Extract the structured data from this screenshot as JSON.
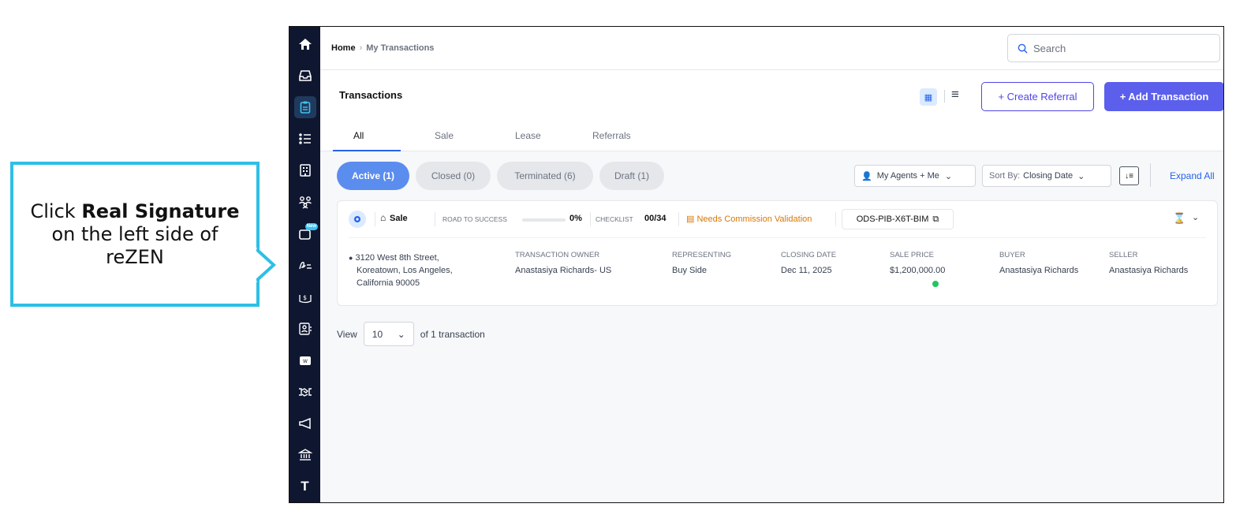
{
  "callout": {
    "pre": "Click ",
    "bold": "Real Signature",
    "post": " on the left side of reZEN"
  },
  "breadcrumb": {
    "home": "Home",
    "separator": "›",
    "current": "My Transactions"
  },
  "search": {
    "placeholder": "Search",
    "icon": "search-icon"
  },
  "header": {
    "title": "Transactions",
    "create_referral": "+ Create Referral",
    "add_transaction": "+ Add Transaction"
  },
  "tabs": [
    {
      "label": "All",
      "active": true
    },
    {
      "label": "Sale"
    },
    {
      "label": "Lease"
    },
    {
      "label": "Referrals"
    }
  ],
  "status_pills": [
    {
      "label": "Active (1)",
      "active": true
    },
    {
      "label": "Closed (0)"
    },
    {
      "label": "Terminated (6)"
    },
    {
      "label": "Draft (1)"
    }
  ],
  "filters": {
    "agents": "My Agents + Me",
    "sort_prefix": "Sort By:",
    "sort_value": "Closing Date",
    "expand_all": "Expand All"
  },
  "transaction": {
    "type": "Sale",
    "road_to_success_label": "ROAD TO SUCCESS",
    "road_to_success_pct": "0%",
    "checklist_label": "CHECKLIST",
    "checklist_value": "00/34",
    "needs_validation": "Needs Commission Validation",
    "code": "ODS-PIB-X6T-BIM",
    "address_line1": "3120 West 8th Street,",
    "address_line2": "Koreatown, Los Angeles,",
    "address_line3": "California 90005",
    "owner_label": "TRANSACTION OWNER",
    "owner_value": "Anastasiya Richards- US",
    "representing_label": "REPRESENTING",
    "representing_value": "Buy Side",
    "closing_label": "CLOSING DATE",
    "closing_value": "Dec 11, 2025",
    "price_label": "SALE PRICE",
    "price_value": "$1,200,000.00",
    "buyer_label": "BUYER",
    "buyer_value": "Anastasiya Richards",
    "seller_label": "SELLER",
    "seller_value": "Anastasiya Richards"
  },
  "pager": {
    "view": "View",
    "page_size": "10",
    "summary": "of 1 transaction"
  },
  "sidebar": {
    "new_badge": "New",
    "last_label": "T"
  },
  "colors": {
    "sidebar_bg": "#0f1730",
    "primary": "#5b5fec",
    "callout_border": "#2ebfe6",
    "warning": "#d97706"
  }
}
